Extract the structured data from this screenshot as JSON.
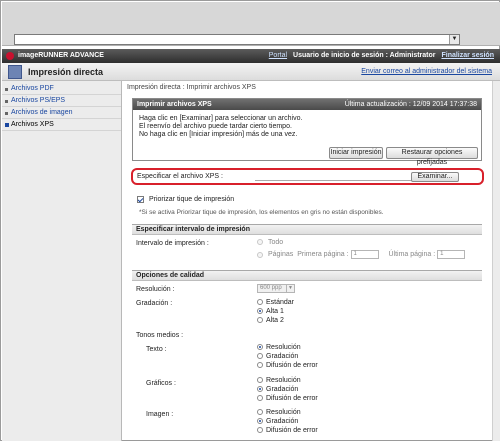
{
  "browser": {
    "dropdown_glyph": "▼"
  },
  "header": {
    "brand": "imageRUNNER ADVANCE",
    "portal_link": "Portal",
    "login_text": "Usuario de inicio de sesión : Administrator",
    "logout_link": "Finalizar sesión"
  },
  "subheader": {
    "title": "Impresión directa",
    "admin_mail_link": "Enviar correo al administrador del sistema"
  },
  "sidebar": {
    "items": [
      {
        "label": "Archivos PDF",
        "active": false
      },
      {
        "label": "Archivos PS/EPS",
        "active": false
      },
      {
        "label": "Archivos de imagen",
        "active": false
      },
      {
        "label": "Archivos XPS",
        "active": true
      }
    ]
  },
  "breadcrumb": {
    "parent": "Impresión directa",
    "sep": ":",
    "current": "Imprimir archivos XPS"
  },
  "print_panel": {
    "title": "Imprimir archivos XPS",
    "updated": "Última actualización : 12/09 2014 17:37:38",
    "messages": [
      "Haga clic en [Examinar] para seleccionar un archivo.",
      "El reenvío del archivo puede tardar cierto tiempo.",
      "No haga clic en [Iniciar impresión] más de una vez."
    ],
    "start_button": "Iniciar impresión",
    "restore_button": "Restaurar opciones prefijadas"
  },
  "file_select": {
    "label": "Especificar el archivo XPS :",
    "browse_button": "Examinar..."
  },
  "priority": {
    "label": "Priorizar tique de impresión",
    "checked": true,
    "note": "*Si se activa Priorizar tique de impresión, los elementos en gris no están disponibles."
  },
  "print_range": {
    "section_title": "Especificar intervalo de impresión",
    "label": "Intervalo de impresión :",
    "all": "Todo",
    "pages": "Páginas",
    "first_page": "Primera página :",
    "first_value": "1",
    "last_page": "Última página :",
    "last_value": "1"
  },
  "quality": {
    "section_title": "Opciones de calidad",
    "resolution_label": "Resolución :",
    "resolution_value": "600 ppp",
    "gradation_label": "Gradación :",
    "gradation_options": [
      "Estándar",
      "Alta 1",
      "Alta 2"
    ],
    "gradation_selected": 1,
    "halftones_label": "Tonos medios :",
    "groups": [
      {
        "label": "Texto :",
        "options": [
          "Resolución",
          "Gradación",
          "Difusión de error"
        ],
        "selected": 0
      },
      {
        "label": "Gráficos :",
        "options": [
          "Resolución",
          "Gradación",
          "Difusión de error"
        ],
        "selected": 1
      },
      {
        "label": "Imagen :",
        "options": [
          "Resolución",
          "Gradación",
          "Difusión de error"
        ],
        "selected": 1
      }
    ]
  }
}
